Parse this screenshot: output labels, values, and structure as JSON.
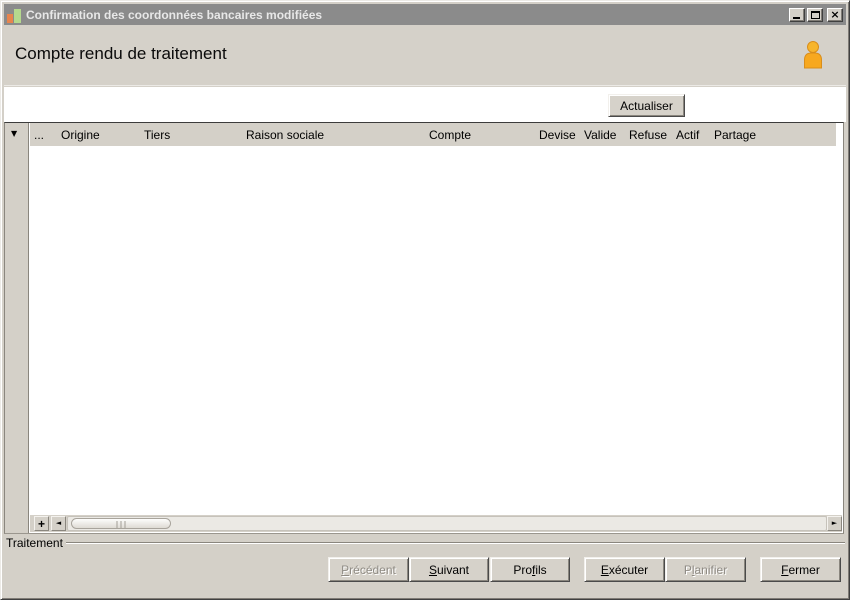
{
  "window": {
    "title": "Confirmation des coordonnées bancaires modifiées"
  },
  "icons": {
    "app": "bar-chart",
    "person": "user-silhouette",
    "close": "×",
    "filter_dropdown": "▼",
    "scroll_left": "◄",
    "scroll_right": "►",
    "add": "+"
  },
  "header": {
    "title": "Compte rendu de traitement"
  },
  "toolbar": {
    "refresh_label": "Actualiser"
  },
  "table": {
    "columns": [
      "...",
      "Origine",
      "Tiers",
      "Raison sociale",
      "Compte",
      "Devise",
      "Valide",
      "Refuse",
      "Actif",
      "Partage"
    ],
    "rows": []
  },
  "footer": {
    "group_label": "Traitement"
  },
  "action_buttons": [
    {
      "name": "precedent",
      "pre": "",
      "key": "P",
      "post": "récédent",
      "disabled": true
    },
    {
      "name": "suivant",
      "pre": "",
      "key": "S",
      "post": "uivant",
      "disabled": false
    },
    {
      "name": "profils",
      "pre": "Pro",
      "key": "f",
      "post": "ils",
      "disabled": false
    },
    {
      "name": "executer",
      "pre": "",
      "key": "E",
      "post": "xécuter",
      "disabled": false
    },
    {
      "name": "planifier",
      "pre": "P",
      "key": "l",
      "post": "anifier",
      "disabled": true
    },
    {
      "name": "fermer",
      "pre": "",
      "key": "F",
      "post": "ermer",
      "disabled": false
    }
  ],
  "colors": {
    "window_bg": "#d4d0c8",
    "titlebar_bg": "#8b8b8b",
    "titlebar_text": "#e8e8e8",
    "table_bg": "#ffffff",
    "header_row_bg": "#d4d0c8",
    "app_icon_orange": "#e8854d",
    "app_icon_green": "#b5d98e",
    "person_icon": "#f7a81f"
  }
}
